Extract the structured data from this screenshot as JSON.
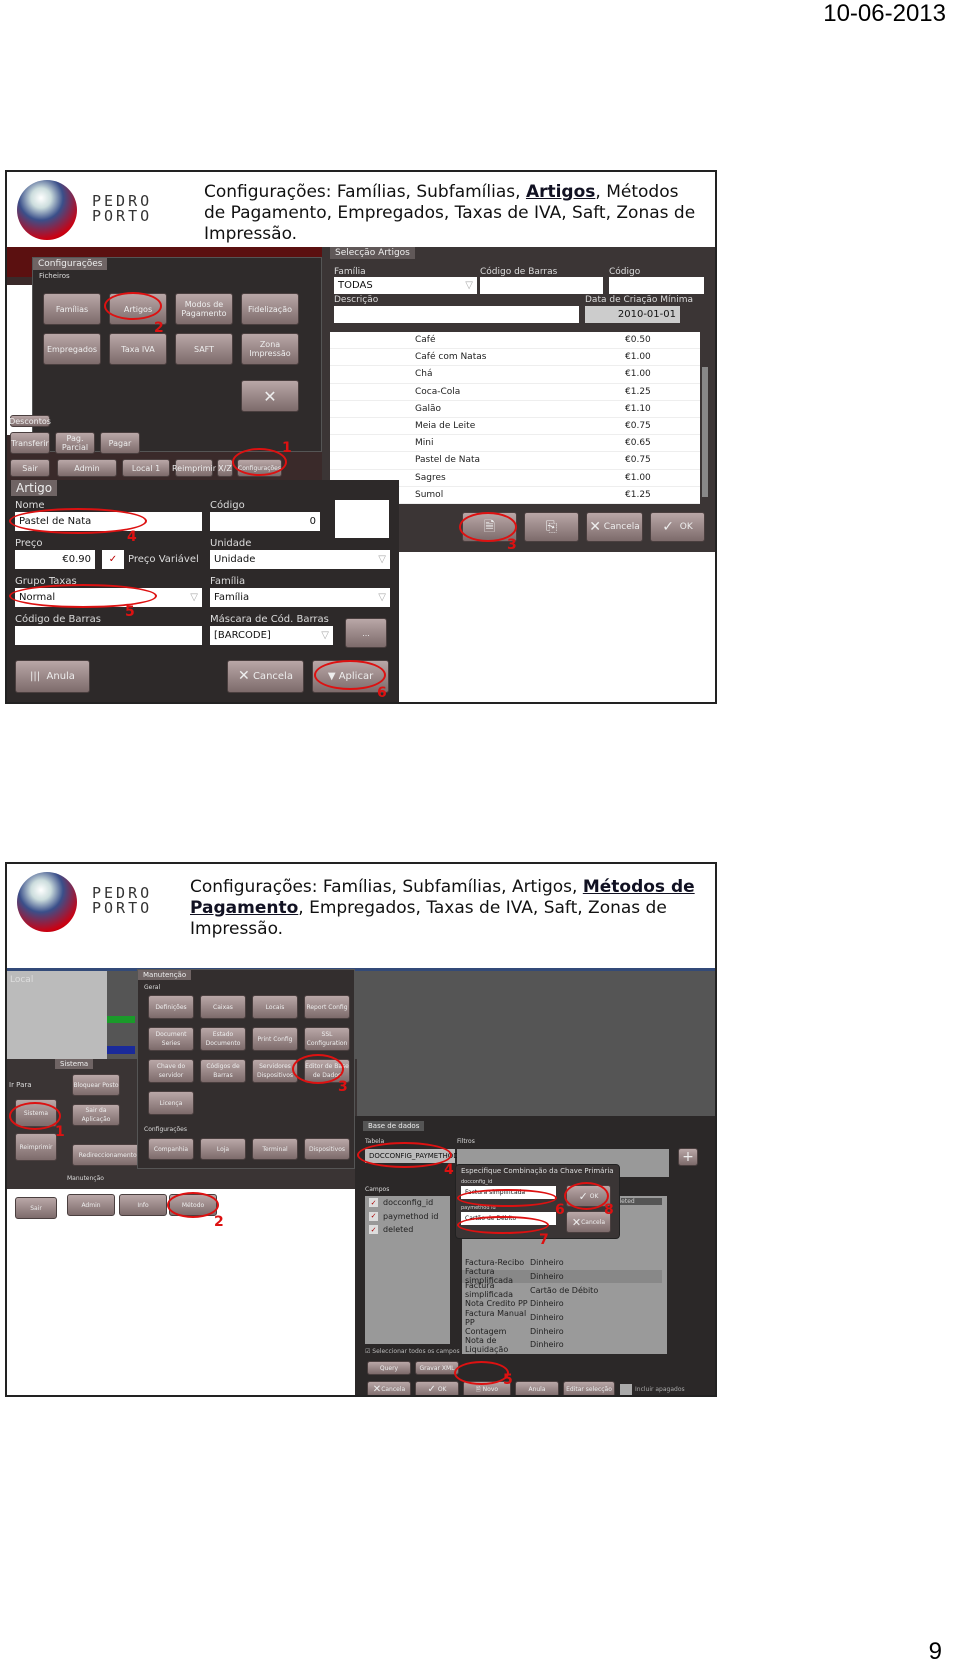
{
  "header": {
    "date": "10-06-2013"
  },
  "footer": {
    "page_number": "9"
  },
  "brand": {
    "line1": "PEDRO",
    "line2": "PORTO"
  },
  "slide1": {
    "title_parts": [
      "Configurações: Famílias, Subfamílias, ",
      "Artigos",
      ", Métodos de Pagamento, Empregados, Taxas de IVA, Saft, Zonas de Impressão."
    ],
    "config_dialog": {
      "tab": "Configurações",
      "section": "Ficheiros",
      "buttons": [
        "Famílias",
        "Artigos",
        "Modos de Pagamento",
        "Fidelização",
        "Empregados",
        "Taxa IVA",
        "SAFT",
        "Zona Impressão"
      ],
      "close": "✕"
    },
    "pos_buttons": [
      "Descontos",
      "Transferir",
      "Pag. Parcial",
      "Pagar",
      "Sair",
      "Admin",
      "Local 1",
      "Reimprimir",
      "X/Z",
      "Configurações"
    ],
    "selection": {
      "tab": "Selecção Artigos",
      "familia_label": "Família",
      "familia_value": "TODAS",
      "barcode_label": "Código de Barras",
      "codigo_label": "Código",
      "descricao_label": "Descrição",
      "date_label": "Data de Criação Mínima",
      "date_value": "2010-01-01",
      "items": [
        {
          "name": "Café",
          "price": "€0.50"
        },
        {
          "name": "Café com Natas",
          "price": "€1.00"
        },
        {
          "name": "Chá",
          "price": "€1.00"
        },
        {
          "name": "Coca-Cola",
          "price": "€1.25"
        },
        {
          "name": "Galão",
          "price": "€1.10"
        },
        {
          "name": "Meia de Leite",
          "price": "€0.75"
        },
        {
          "name": "Mini",
          "price": "€0.65"
        },
        {
          "name": "Pastel de Nata",
          "price": "€0.75"
        },
        {
          "name": "Sagres",
          "price": "€1.00"
        },
        {
          "name": "Sumol",
          "price": "€1.25"
        }
      ],
      "cancel": "Cancela",
      "ok": "OK"
    },
    "artigo": {
      "tab": "Artigo",
      "nome_label": "Nome",
      "nome_value": "Pastel de Nata",
      "codigo_label": "Código",
      "codigo_value": "0",
      "preco_label": "Preço",
      "preco_value": "€0.90",
      "preco_variavel": "Preço Variável",
      "unidade_label": "Unidade",
      "unidade_value": "Unidade",
      "grupo_label": "Grupo Taxas",
      "grupo_value": "Normal",
      "familia_label": "Família",
      "familia_value": "Família",
      "barcode_label": "Código de Barras",
      "mask_label": "Máscara de Cód. Barras",
      "mask_value": "[BARCODE]",
      "more": "...",
      "anula": "Anula",
      "cancela": "Cancela",
      "aplicar": "Aplicar"
    },
    "steps": [
      "1",
      "2",
      "3",
      "4",
      "5",
      "6"
    ]
  },
  "slide2": {
    "title_parts": [
      "Configurações: Famílias, Subfamílias, Artigos, ",
      "Métodos de Pagamento",
      ", Empregados, Taxas de IVA, Saft, Zonas de Impressão."
    ],
    "local_label": "Local",
    "ir_para": "Ir Para",
    "manutencao": {
      "tab": "Manutenção",
      "geral": "Geral",
      "buttons": [
        "Definições",
        "Caixas",
        "Locais",
        "Report Config",
        "Document Series",
        "Estado Documento",
        "Print Config",
        "SSL Configuration",
        "Chave do servidor",
        "Códigos de Barras",
        "Servidores Dispositivos",
        "Editor de Base de Dados",
        "Licença"
      ],
      "config_label": "Configurações",
      "config_buttons": [
        "Companhia",
        "Loja",
        "Terminal",
        "Dispositivos"
      ]
    },
    "sistema": {
      "tab": "Sistema",
      "buttons": [
        "Bloquear Posto",
        "Sair da Aplicação",
        "Redireccionamento Impressoras"
      ],
      "left_buttons": [
        "Sistema",
        "Reimprimir",
        "Sair"
      ],
      "manutencao": "Manutenção",
      "bottom": [
        "Admin",
        "Info",
        "Método"
      ]
    },
    "db": {
      "tab": "Base de dados",
      "tabela_label": "Tabela",
      "tabela_value": "DOCCONFIG_PAYMETHOD",
      "filtros_label": "Filtros",
      "campos_label": "Campos",
      "campos": [
        {
          "name": "docconfig_id",
          "checked": true
        },
        {
          "name": "paymethod id",
          "checked": true
        },
        {
          "name": "deleted",
          "checked": true
        }
      ],
      "select_all": "Seleccionar todos os campos",
      "query": "Query",
      "gravar": "Gravar XML",
      "col_deleted": "deleted",
      "rows": [
        [
          "Factura-Recibo",
          "Dinheiro"
        ],
        [
          "Factura simplificada",
          "Dinheiro"
        ],
        [
          "Factura simplificada",
          "Cartão de Débito"
        ],
        [
          "Nota Credito PP",
          "Dinheiro"
        ],
        [
          "Factura Manual PP",
          "Dinheiro"
        ],
        [
          "Contagem",
          "Dinheiro"
        ],
        [
          "Nota de Liquidação",
          "Dinheiro"
        ]
      ],
      "cancela": "Cancela",
      "ok": "OK",
      "novo": "Novo",
      "anula": "Anula",
      "editar": "Editar selecção",
      "incluir": "Incluir apagados"
    },
    "pk_dialog": {
      "title": "Especifique Combinação da Chave Primária",
      "f1_label": "docconfig_id",
      "f1_value": "Factura simplificada",
      "f2_label": "paymethod id",
      "f2_value": "Cartão de Débito",
      "ok": "OK",
      "cancela": "Cancela"
    },
    "steps": [
      "1",
      "2",
      "3",
      "4",
      "5",
      "6",
      "7",
      "8"
    ]
  }
}
